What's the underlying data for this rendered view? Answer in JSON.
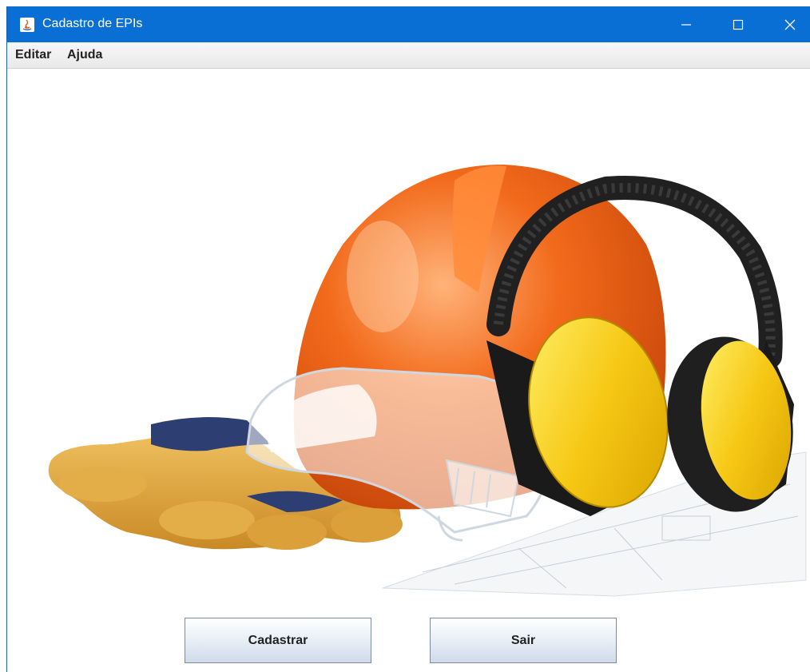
{
  "window": {
    "title": "Cadastro de EPIs",
    "accent_color": "#0a6fd4"
  },
  "menu": {
    "items": [
      {
        "label": "Editar"
      },
      {
        "label": "Ajuda"
      }
    ]
  },
  "illustration": {
    "icons": [
      "hard-hat-icon",
      "safety-goggles-icon",
      "ear-muffs-icon",
      "work-gloves-icon",
      "blueprint-icon"
    ],
    "colors": {
      "helmet": "#f26a1b",
      "earmuffs": "#f6c814",
      "gloves": "#e0a73a"
    }
  },
  "buttons": {
    "cadastrar": "Cadastrar",
    "sair": "Sair"
  }
}
